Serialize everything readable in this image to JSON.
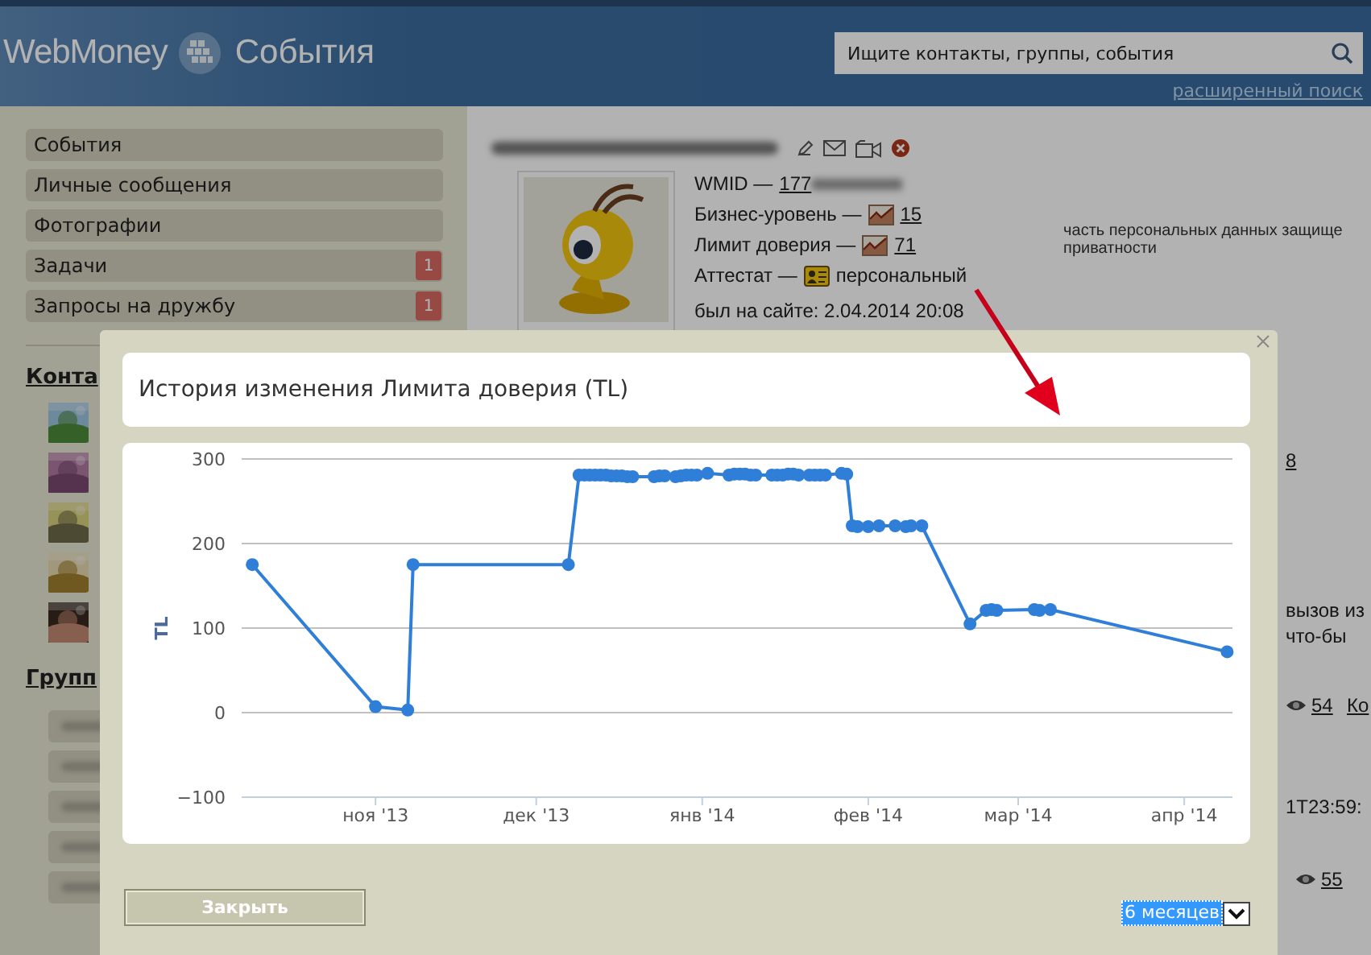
{
  "header": {
    "logo": "WebMoney",
    "section": "События",
    "search": {
      "placeholder": "Ищите контакты, группы, события"
    },
    "advanced_search": "расширенный поиск"
  },
  "sidebar": {
    "items": [
      {
        "label": "События"
      },
      {
        "label": "Личные сообщения"
      },
      {
        "label": "Фотографии"
      },
      {
        "label": "Задачи",
        "badge": "1"
      },
      {
        "label": "Запросы на дружбу",
        "badge": "1"
      }
    ],
    "contacts_heading": "Конта",
    "groups_heading": "Групп"
  },
  "profile": {
    "fields": [
      {
        "kind": "id",
        "label": "WMID —",
        "value": "177"
      },
      {
        "kind": "chart",
        "label": "Бизнес-уровень —",
        "value": "15"
      },
      {
        "kind": "chart",
        "label": "Лимит доверия —",
        "value": "71"
      },
      {
        "kind": "certificate",
        "label": "Аттестат —",
        "value": "персональный"
      }
    ],
    "last_seen": "был на сайте: 2.04.2014 20:08",
    "privacy_note": [
      "часть персональных данных защище",
      "приватности"
    ]
  },
  "feed_fragments": [
    {
      "kind": "link",
      "text": "8"
    },
    {
      "kind": "text",
      "text": "вызов из"
    },
    {
      "kind": "text",
      "text": "что-бы"
    },
    {
      "kind": "views",
      "text": "54"
    },
    {
      "kind": "link",
      "text": "Ко"
    },
    {
      "kind": "text",
      "text": "1T23:59:"
    },
    {
      "kind": "views",
      "text": "55"
    }
  ],
  "modal": {
    "title": "История изменения Лимита доверия (TL)",
    "chart_data": {
      "type": "line",
      "grid": true,
      "ylabel": "TL",
      "xlim": [
        "2013-10-07",
        "2014-04-10"
      ],
      "ylim": [
        -100,
        300
      ],
      "yticks": [
        -100,
        0,
        100,
        200,
        300
      ],
      "xticks": [
        {
          "value": "2013-11-01",
          "label": "ноя '13"
        },
        {
          "value": "2013-12-01",
          "label": "дек '13"
        },
        {
          "value": "2014-01-01",
          "label": "янв '14"
        },
        {
          "value": "2014-02-01",
          "label": "фев '14"
        },
        {
          "value": "2014-03-01",
          "label": "мар '14"
        },
        {
          "value": "2014-04-01",
          "label": "апр '14"
        }
      ],
      "x": [
        "2013-10-09",
        "2013-11-01",
        "2013-11-07",
        "2013-11-08",
        "2013-12-07",
        "2013-12-09",
        "2013-12-10",
        "2013-12-11",
        "2013-12-12",
        "2013-12-13",
        "2013-12-14",
        "2013-12-15",
        "2013-12-16",
        "2013-12-17",
        "2013-12-18",
        "2013-12-19",
        "2013-12-23",
        "2013-12-24",
        "2013-12-25",
        "2013-12-27",
        "2013-12-28",
        "2013-12-29",
        "2013-12-30",
        "2013-12-31",
        "2014-01-02",
        "2014-01-06",
        "2014-01-07",
        "2014-01-08",
        "2014-01-09",
        "2014-01-10",
        "2014-01-11",
        "2014-01-14",
        "2014-01-15",
        "2014-01-16",
        "2014-01-17",
        "2014-01-18",
        "2014-01-19",
        "2014-01-21",
        "2014-01-22",
        "2014-01-23",
        "2014-01-24",
        "2014-01-27",
        "2014-01-28",
        "2014-01-29",
        "2014-01-30",
        "2014-02-01",
        "2014-02-03",
        "2014-02-06",
        "2014-02-08",
        "2014-02-09",
        "2014-02-11",
        "2014-02-20",
        "2014-02-23",
        "2014-02-24",
        "2014-02-25",
        "2014-03-04",
        "2014-03-05",
        "2014-03-07",
        "2014-04-09"
      ],
      "series": [
        {
          "marker": "circle",
          "color": "#2f7ed8",
          "values": [
            175,
            7,
            3,
            175,
            175,
            281,
            281,
            281,
            281,
            281,
            281,
            280,
            280,
            280,
            279,
            279,
            279,
            280,
            280,
            279,
            280,
            281,
            281,
            281,
            283,
            281,
            282,
            282,
            282,
            281,
            281,
            281,
            281,
            281,
            282,
            282,
            281,
            281,
            281,
            281,
            281,
            283,
            282,
            221,
            220,
            220,
            221,
            221,
            220,
            221,
            221,
            105,
            121,
            122,
            121,
            122,
            121,
            122,
            72
          ]
        }
      ]
    },
    "close_button": "Закрыть",
    "period": "6 месяцев"
  }
}
